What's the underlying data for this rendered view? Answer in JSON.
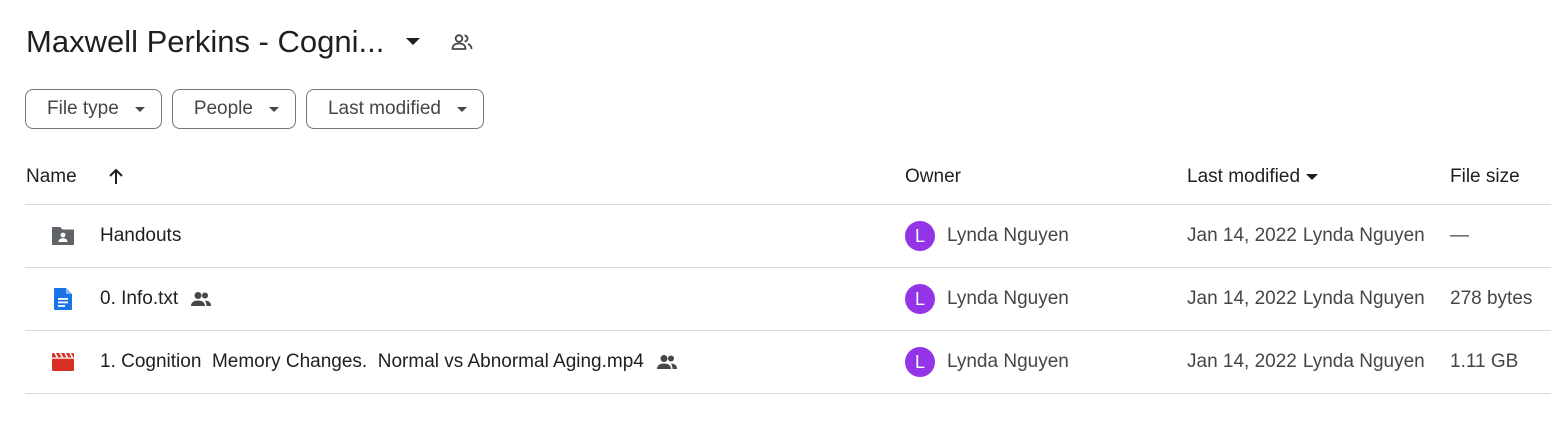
{
  "header": {
    "folder_title": "Maxwell Perkins - Cogni...",
    "title_dropdown_icon": "arrow-drop-down-icon",
    "shared_icon": "people-icon"
  },
  "filters": {
    "file_type": "File type",
    "people": "People",
    "last_modified": "Last modified"
  },
  "table": {
    "columns": {
      "name": "Name",
      "owner": "Owner",
      "last_modified": "Last modified",
      "file_size": "File size"
    },
    "sort": {
      "column": "Last modified",
      "direction": "descending",
      "name_sort_icon": "arrow-upward-icon"
    },
    "rows": [
      {
        "icon": "shared-folder-icon",
        "icon_color": "#5f6368",
        "name": "Handouts",
        "shared": false,
        "owner_initial": "L",
        "owner": "Lynda Nguyen",
        "modified_date": "Jan 14, 2022",
        "modified_by": "Lynda Nguyen",
        "size": "—"
      },
      {
        "icon": "document-icon",
        "icon_color": "#1a73e8",
        "name": "0. Info.txt",
        "shared": true,
        "owner_initial": "L",
        "owner": "Lynda Nguyen",
        "modified_date": "Jan 14, 2022",
        "modified_by": "Lynda Nguyen",
        "size": "278 bytes"
      },
      {
        "icon": "video-icon",
        "icon_color": "#d93025",
        "name": "1. Cognition  Memory Changes.  Normal vs Abnormal Aging.mp4",
        "shared": true,
        "owner_initial": "L",
        "owner": "Lynda Nguyen",
        "modified_date": "Jan 14, 2022",
        "modified_by": "Lynda Nguyen",
        "size": "1.11 GB"
      }
    ]
  },
  "colors": {
    "avatar": "#9334e6",
    "divider": "#dadce0",
    "chip_border": "#747775"
  }
}
